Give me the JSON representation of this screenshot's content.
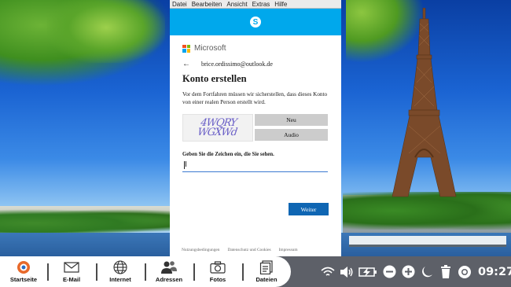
{
  "menu": {
    "items": [
      "Datei",
      "Bearbeiten",
      "Ansicht",
      "Extras",
      "Hilfe"
    ]
  },
  "app": {
    "logo_letter": "S"
  },
  "dialog": {
    "brand": "Microsoft",
    "email": "brice.ordissimo@outlook.de",
    "title": "Konto erstellen",
    "description": "Vor dem Fortfahren müssen wir sicherstellen, dass dieses Konto von einer realen Person erstellt wird.",
    "captcha_text": "4WQRY WGXWd",
    "new_button": "Neu",
    "audio_button": "Audio",
    "field_label": "Geben Sie die Zeichen ein, die Sie sehen.",
    "field_value": "",
    "next_button": "Weiter",
    "footer_links": [
      "Nutzungsbedingungen",
      "Datenschutz und Cookies",
      "Impressum"
    ]
  },
  "taskbar": {
    "items": [
      {
        "label": "Startseite",
        "icon": "home-logo-icon"
      },
      {
        "label": "E-Mail",
        "icon": "mail-icon"
      },
      {
        "label": "Internet",
        "icon": "globe-icon"
      },
      {
        "label": "Adressen",
        "icon": "contacts-icon"
      },
      {
        "label": "Fotos",
        "icon": "camera-icon"
      },
      {
        "label": "Dateien",
        "icon": "files-icon"
      }
    ],
    "tray_icons": [
      "wifi-icon",
      "volume-icon",
      "battery-charging-icon",
      "zoom-out-icon",
      "zoom-in-icon",
      "moon-icon",
      "trash-icon",
      "help-lifebuoy-icon"
    ],
    "clock": "09:27"
  },
  "colors": {
    "skype_blue": "#00a8ec",
    "accent_blue": "#0f66b3",
    "taskbar_gray": "#5d6068"
  }
}
